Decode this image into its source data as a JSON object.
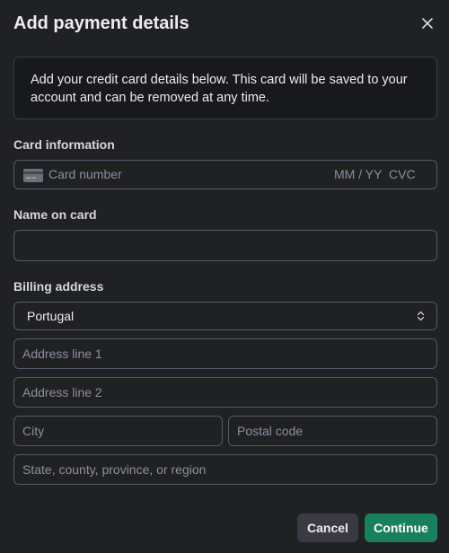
{
  "dialog": {
    "title": "Add payment details",
    "close_icon": "close-icon"
  },
  "info": {
    "text": "Add your credit card details below. This card will be saved to your account and can be removed at any time."
  },
  "card_information": {
    "label": "Card information",
    "icon": "credit-card-icon",
    "number_placeholder": "Card number",
    "expiry_placeholder": "MM / YY",
    "cvc_placeholder": "CVC"
  },
  "name_on_card": {
    "label": "Name on card",
    "value": "",
    "placeholder": ""
  },
  "billing_address": {
    "label": "Billing address",
    "country": {
      "selected": "Portugal",
      "icon": "chevron-updown-icon"
    },
    "address_line1_placeholder": "Address line 1",
    "address_line2_placeholder": "Address line 2",
    "city_placeholder": "City",
    "postal_code_placeholder": "Postal code",
    "region_placeholder": "State, county, province, or region"
  },
  "actions": {
    "cancel_label": "Cancel",
    "continue_label": "Continue"
  },
  "colors": {
    "background": "#202123",
    "accent": "#19805f",
    "border": "#565869"
  }
}
